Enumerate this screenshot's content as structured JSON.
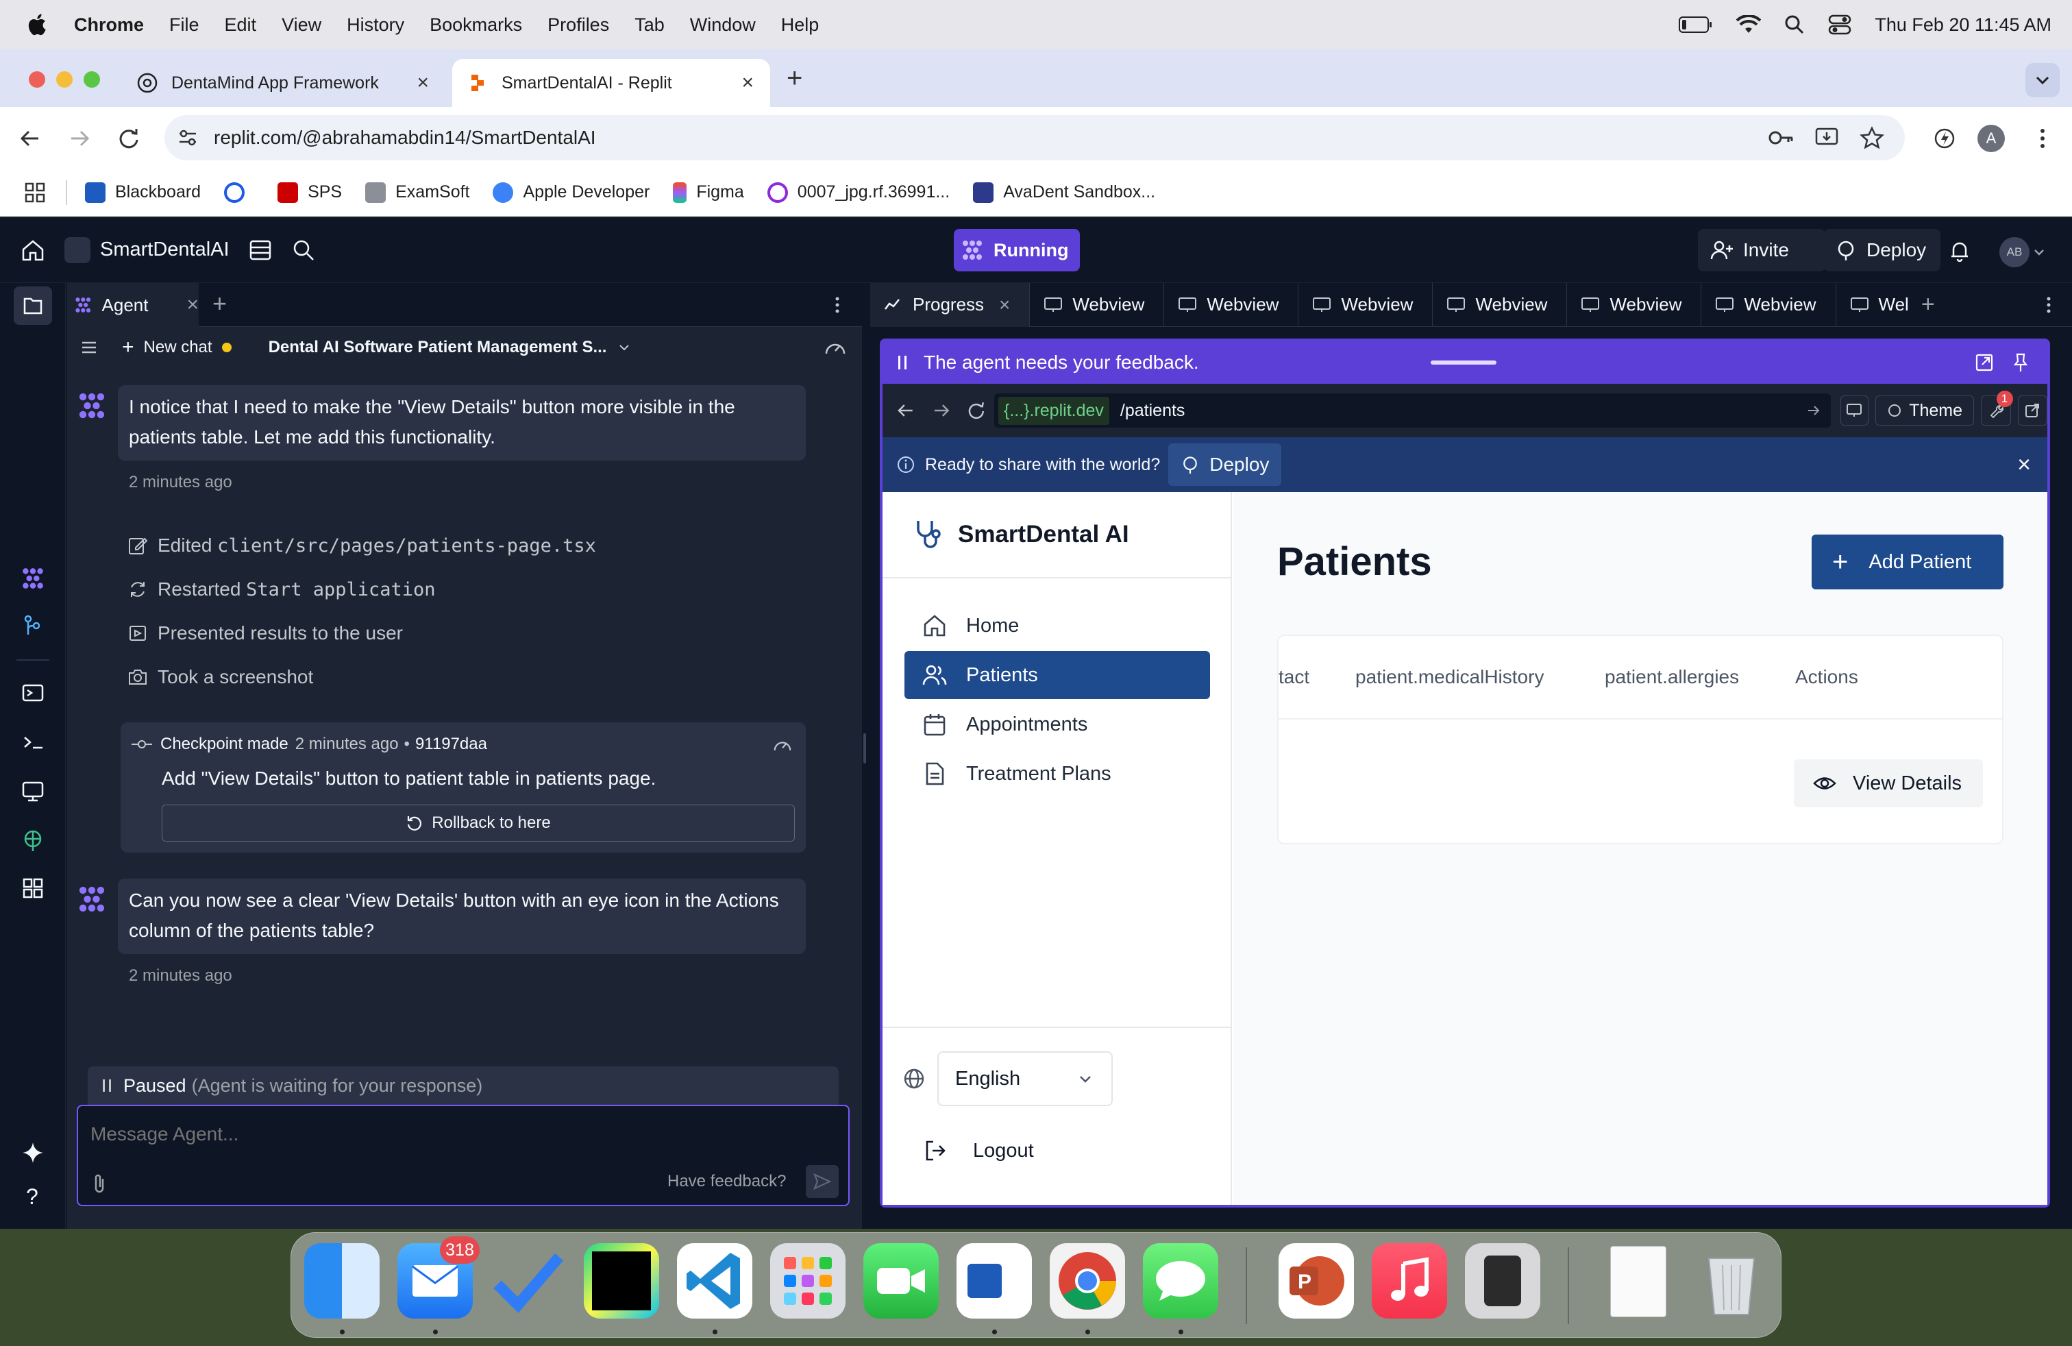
{
  "menubar": {
    "app": "Chrome",
    "items": [
      "File",
      "Edit",
      "View",
      "History",
      "Bookmarks",
      "Profiles",
      "Tab",
      "Window",
      "Help"
    ],
    "clock": "Thu Feb 20  11:45 AM"
  },
  "browser": {
    "tabs": [
      {
        "title": "DentaMind App Framework"
      },
      {
        "title": "SmartDentalAI - Replit"
      }
    ],
    "url": "replit.com/@abrahamabdin14/SmartDentalAI",
    "profile_initial": "A",
    "bookmarks": [
      "Blackboard",
      "SPS",
      "ExamSoft",
      "Apple Developer",
      "Figma",
      "0007_jpg.rf.36991...",
      "AvaDent Sandbox..."
    ]
  },
  "replit": {
    "project_name": "SmartDentalAI",
    "running_label": "Running",
    "invite_label": "Invite",
    "deploy_label": "Deploy",
    "user_initials": "AB",
    "agent_tab": "Agent",
    "new_chat": "New chat",
    "chat_title": "Dental AI Software Patient Management S...",
    "messages": [
      {
        "text": "I notice that I need to make the \"View Details\" button more visible in the patients table. Let me add this functionality.",
        "time": "2 minutes ago"
      },
      {
        "text": "Can you now see a clear 'View Details' button with an eye icon in the Actions column of the patients table?",
        "time": "2 minutes ago"
      }
    ],
    "actions": [
      {
        "prefix": "Edited ",
        "code": "client/src/pages/patients-page.tsx"
      },
      {
        "prefix": "Restarted ",
        "code": "Start application"
      },
      {
        "prefix": "Presented results to the user",
        "code": ""
      },
      {
        "prefix": "Took a screenshot",
        "code": ""
      }
    ],
    "checkpoint": {
      "label": "Checkpoint made",
      "time": "2 minutes ago",
      "hash": "91197daa",
      "description": "Add \"View Details\" button to patient table in patients page.",
      "rollback_label": "Rollback to here"
    },
    "paused_label": "Paused",
    "paused_note": "(Agent is waiting for your response)",
    "composer_placeholder": "Message Agent...",
    "feedback_label": "Have feedback?",
    "pane_tabs": [
      "Progress",
      "Webview",
      "Webview",
      "Webview",
      "Webview",
      "Webview",
      "Webview",
      "Wel"
    ],
    "feedback_banner": "The agent needs your feedback.",
    "webview_domain": "{...}.replit.dev",
    "webview_path": "/patients",
    "theme_label": "Theme",
    "notif_count": "1",
    "share_prompt": "Ready to share with the world?",
    "share_deploy": "Deploy"
  },
  "app": {
    "brand": "SmartDental AI",
    "nav": [
      "Home",
      "Patients",
      "Appointments",
      "Treatment Plans"
    ],
    "page_title": "Patients",
    "add_button": "Add Patient",
    "table_headers": [
      "tact",
      "patient.medicalHistory",
      "patient.allergies",
      "Actions"
    ],
    "view_details": "View Details",
    "language": "English",
    "logout": "Logout"
  },
  "dock": {
    "mail_badge": "318",
    "apps": [
      "Finder",
      "Mail",
      "Tasks",
      "PyCharm",
      "VS Code",
      "Launchpad",
      "FaceTime",
      "Word",
      "Chrome",
      "Messages",
      "PowerPoint",
      "Music",
      "Calculator",
      "Document",
      "Trash"
    ]
  },
  "colors": {
    "replit_bg": "#0e1525",
    "replit_panel": "#1c2333",
    "accent_purple": "#5b3fd6",
    "app_primary": "#1e4a8e"
  }
}
